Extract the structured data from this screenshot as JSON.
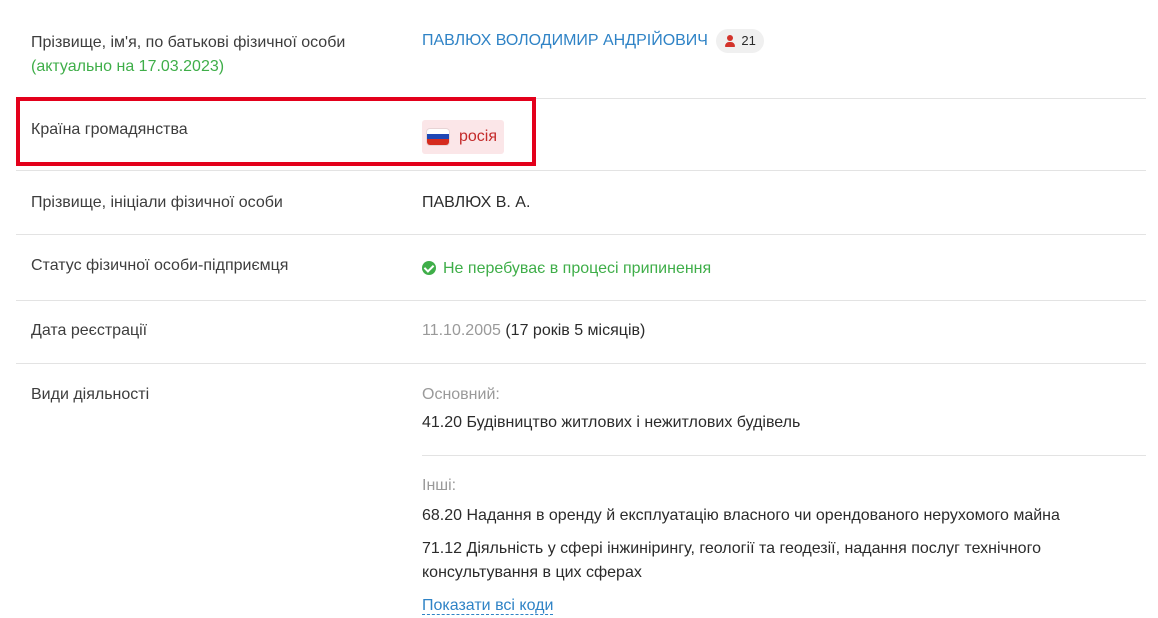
{
  "rows": {
    "name": {
      "label": "Прізвище, ім'я, по батькові фізичної особи",
      "actual": "(актуально на 17.03.2023)",
      "value": "ПАВЛЮХ ВОЛОДИМИР АНДРІЙОВИЧ",
      "badge_count": "21",
      "badge_icon": "person-icon"
    },
    "citizenship": {
      "label": "Країна громадянства",
      "value": "росія",
      "flag_icon": "russia-flag-icon",
      "flag_colors": [
        "#ffffff",
        "#1f47b5",
        "#d52b1e"
      ],
      "highlight_color": "#e3001b"
    },
    "initials": {
      "label": "Прізвище, ініціали фізичної особи",
      "value": "ПАВЛЮХ В. А."
    },
    "status": {
      "label": "Статус фізичної особи-підприємця",
      "value": "Не перебуває в процесі припинення",
      "icon": "check-circle-icon",
      "color": "#3fae49"
    },
    "registration": {
      "label": "Дата реєстрації",
      "date": "11.10.2005",
      "duration": "(17 років 5 місяців)"
    },
    "activities": {
      "label": "Види діяльності",
      "main_title": "Основний:",
      "main_item": "41.20 Будівництво житлових і нежитлових будівель",
      "other_title": "Інші:",
      "other_items": [
        "68.20 Надання в оренду й експлуатацію власного чи орендованого нерухомого майна",
        "71.12 Діяльність у сфері інжинірингу, геології та геодезії, надання послуг технічного консультування в цих сферах"
      ],
      "show_all": "Показати всі коди"
    }
  }
}
